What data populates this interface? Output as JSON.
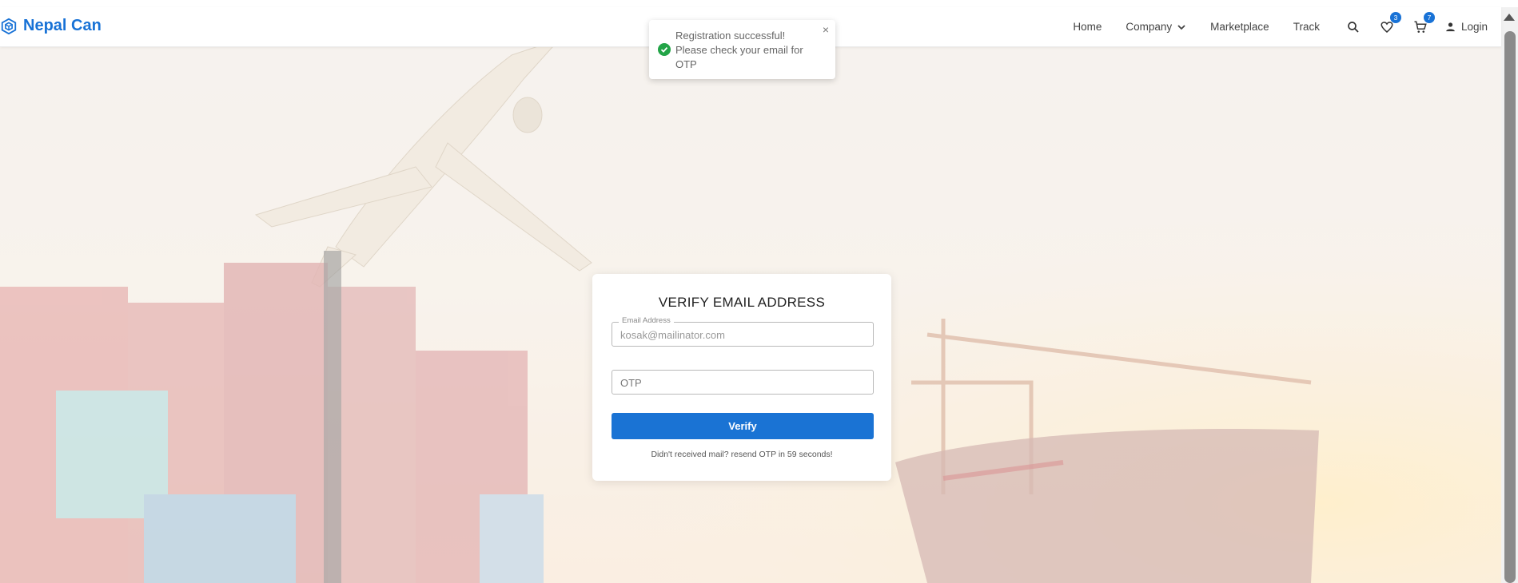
{
  "brand": {
    "name": "Nepal Can"
  },
  "nav": {
    "home": "Home",
    "company": "Company",
    "marketplace": "Marketplace",
    "track": "Track",
    "wishlist_count": "3",
    "cart_count": "7",
    "login": "Login"
  },
  "toast": {
    "message": "Registration successful! Please check your email for OTP",
    "close": "×"
  },
  "verify": {
    "title": "VERIFY EMAIL ADDRESS",
    "email_label": "Email Address",
    "email_value": "kosak@mailinator.com",
    "otp_placeholder": "OTP",
    "button": "Verify",
    "resend_text": "Didn't received mail? resend OTP in 59 seconds!"
  },
  "icons": {
    "logo": "cube-logo-icon",
    "company": "chevron-down-icon",
    "search": "search-icon",
    "wishlist": "heart-icon",
    "cart": "cart-icon",
    "login": "user-icon",
    "toast": "check-circle-icon"
  },
  "colors": {
    "brand": "#1872d6",
    "success": "#22a447",
    "button": "#1a73d4"
  }
}
